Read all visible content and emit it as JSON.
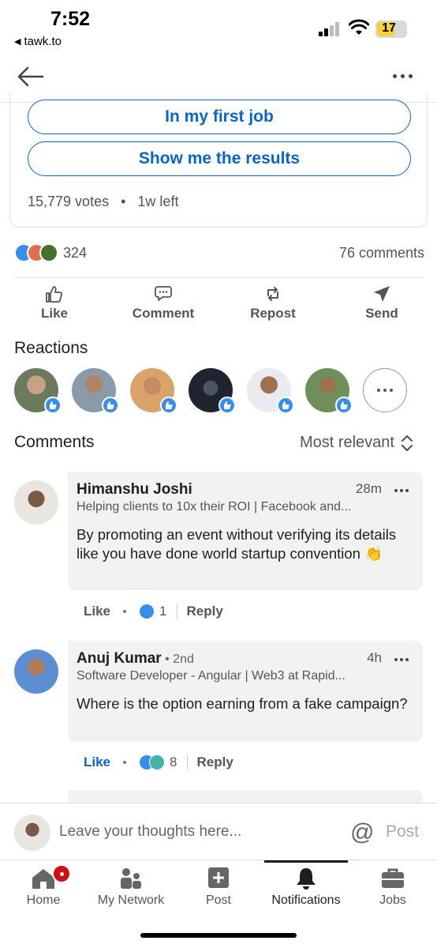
{
  "status_bar": {
    "time": "7:52",
    "back_app": "tawk.to",
    "battery": "17"
  },
  "poll": {
    "options": [
      "In my first job",
      "Show me the results"
    ],
    "votes": "15,779 votes",
    "time_left": "1w left"
  },
  "social": {
    "reaction_count": "324",
    "comments_count": "76 comments"
  },
  "actions": {
    "like": "Like",
    "comment": "Comment",
    "repost": "Repost",
    "send": "Send"
  },
  "reactions": {
    "title": "Reactions"
  },
  "comments_section": {
    "title": "Comments",
    "sort": "Most relevant"
  },
  "comments": [
    {
      "name": "Himanshu Joshi",
      "degree": "",
      "time": "28m",
      "headline": "Helping clients to 10x their ROI | Facebook and...",
      "text": "By promoting an event without verifying its details like you have done world startup convention 👏",
      "like": "Like",
      "reaction_count": "1",
      "reply": "Reply"
    },
    {
      "name": "Anuj Kumar",
      "degree": " • 2nd",
      "time": "4h",
      "headline": "Software Developer - Angular | Web3 at Rapid...",
      "text": "Where is the option earning from a fake campaign?",
      "like": "Like",
      "reaction_count": "8",
      "reply": "Reply"
    }
  ],
  "composer": {
    "placeholder": "Leave your thoughts here...",
    "at": "@",
    "post": "Post"
  },
  "tabs": [
    {
      "label": "Home"
    },
    {
      "label": "My Network"
    },
    {
      "label": "Post"
    },
    {
      "label": "Notifications"
    },
    {
      "label": "Jobs"
    }
  ],
  "colors": {
    "accent": "#0a66c2",
    "like_blue": "#378fe9",
    "badge_red": "#cc1016"
  }
}
